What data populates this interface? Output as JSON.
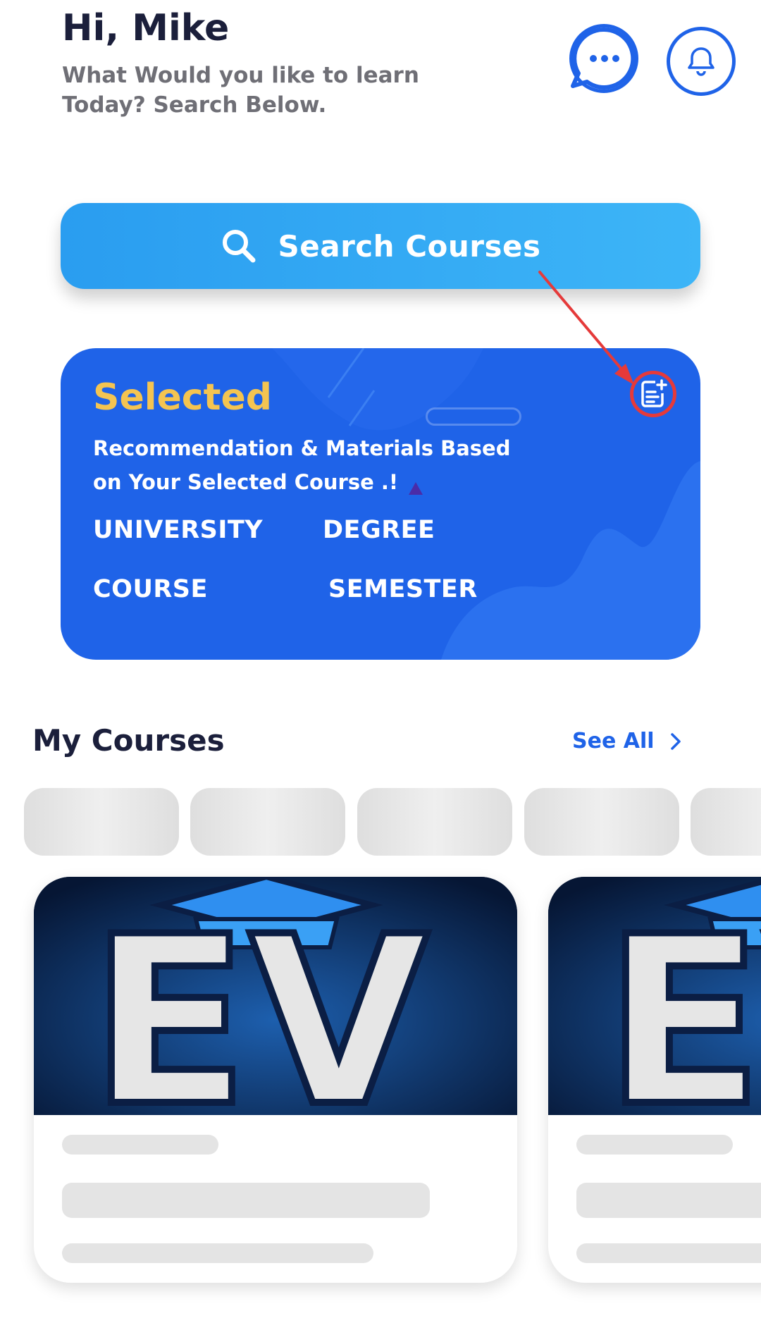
{
  "header": {
    "greeting": "Hi, Mike",
    "subtitle": "What Would you like to learn Today? Search Below.",
    "chat_icon": "chat-bubble-icon",
    "bell_icon": "bell-icon"
  },
  "search": {
    "label": "Search Courses",
    "icon": "search-icon"
  },
  "selected_card": {
    "title": "Selected",
    "description": "Recommendation & Materials Based on Your Selected Course .!",
    "fields": {
      "university": "UNIVERSITY",
      "degree": "DEGREE",
      "course": "COURSE",
      "semester": "SEMESTER"
    },
    "add_icon": "add-document-icon"
  },
  "my_courses": {
    "title": "My Courses",
    "see_all": "See All",
    "cards": [
      {
        "image_text": "EV"
      },
      {
        "image_text": "EV"
      }
    ]
  },
  "colors": {
    "primary_blue": "#1f63e8",
    "search_blue": "#3db5f7",
    "selected_title_yellow": "#f4c451",
    "annotation_red": "#e53a3a"
  }
}
